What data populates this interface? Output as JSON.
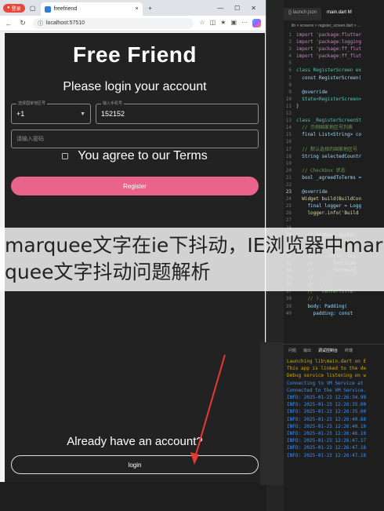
{
  "browser": {
    "profile_label": "登录",
    "tab_title": "freefriend",
    "url": "localhost:57510",
    "tab_close": "×",
    "new_tab": "+",
    "win_min": "—",
    "win_max": "☐",
    "win_close": "✕"
  },
  "app": {
    "title": "Free Friend",
    "subtitle": "Please login your account",
    "country_label": "选择国家地区号",
    "country_value": "+1",
    "phone_label": "输入手机号",
    "phone_value": "152152",
    "password_placeholder": "请输入密码",
    "agree_text": "You agree to our Terms",
    "register_label": "Register",
    "already_text": "Already have an account?",
    "login_label": "login"
  },
  "editor": {
    "tabs": [
      "{} launch.json",
      "main.dart M"
    ],
    "breadcrumb": "lib > screens > register_screen.dart > ...",
    "code": [
      {
        "n": "1",
        "t": "import 'package:flutter",
        "c": "k"
      },
      {
        "n": "2",
        "t": "import 'package:logging",
        "c": "k"
      },
      {
        "n": "3",
        "t": "import 'package:ff_flut",
        "c": "k"
      },
      {
        "n": "4",
        "t": "import 'package:ff_flut",
        "c": "k"
      },
      {
        "n": "5",
        "t": "",
        "c": ""
      },
      {
        "n": "6",
        "t": "class RegisterScreen ex",
        "c": "t"
      },
      {
        "n": "7",
        "t": "  const RegisterScreen(",
        "c": ""
      },
      {
        "n": "8",
        "t": "",
        "c": ""
      },
      {
        "n": "9",
        "t": "  @override",
        "c": ""
      },
      {
        "n": "10",
        "t": "  State<RegisterScreen>",
        "c": "t"
      },
      {
        "n": "11",
        "t": "}",
        "c": ""
      },
      {
        "n": "12",
        "t": "",
        "c": ""
      },
      {
        "n": "13",
        "t": "class _RegisterScreenSt",
        "c": "t"
      },
      {
        "n": "14",
        "t": "  // 示例国家地区号列表",
        "c": "c"
      },
      {
        "n": "15",
        "t": "  final List<String> co",
        "c": ""
      },
      {
        "n": "16",
        "t": "",
        "c": ""
      },
      {
        "n": "17",
        "t": "  // 默认选择的国家地区号",
        "c": "c"
      },
      {
        "n": "18",
        "t": "  String selectedCountr",
        "c": ""
      },
      {
        "n": "19",
        "t": "",
        "c": ""
      },
      {
        "n": "20",
        "t": "  // Checkbox 状态",
        "c": "c"
      },
      {
        "n": "21",
        "t": "  bool _agreedToTerms =",
        "c": ""
      },
      {
        "n": "22",
        "t": "",
        "c": ""
      },
      {
        "n": "23",
        "t": "  @override",
        "c": ""
      },
      {
        "n": "24",
        "t": "  Widget build(BuildCon",
        "c": "f"
      },
      {
        "n": "25",
        "t": "    final logger = Logg",
        "c": ""
      },
      {
        "n": "26",
        "t": "    logger.info('Build",
        "c": "f"
      },
      {
        "n": "27",
        "t": "",
        "c": ""
      },
      {
        "n": "28",
        "t": "",
        "c": ""
      },
      {
        "n": "29",
        "t": "    // appBar: AppBar",
        "c": "c"
      },
      {
        "n": "30",
        "t": "    //   title: const",
        "c": "c"
      },
      {
        "n": "31",
        "t": "    //     'Free Frie",
        "c": "c"
      },
      {
        "n": "32",
        "t": "    //     style: Tex",
        "c": "c"
      },
      {
        "n": "33",
        "t": "    //       fontSize",
        "c": "c"
      },
      {
        "n": "34",
        "t": "    //       fontWeig",
        "c": "c"
      },
      {
        "n": "35",
        "t": "    //     ),",
        "c": "c"
      },
      {
        "n": "36",
        "t": "    //   ),",
        "c": "c"
      },
      {
        "n": "37",
        "t": "    //   centerTitle:",
        "c": "c"
      },
      {
        "n": "38",
        "t": "    // ),",
        "c": "c"
      },
      {
        "n": "39",
        "t": "    body: Padding(",
        "c": ""
      },
      {
        "n": "40",
        "t": "      padding: const",
        "c": ""
      }
    ],
    "panel_tabs": [
      "问题",
      "输出",
      "调试控制台",
      "终端"
    ],
    "console": [
      {
        "t": "Launching lib\\main.dart on E",
        "c": "y"
      },
      {
        "t": "This app is linked to the de",
        "c": "y"
      },
      {
        "t": "Debug service listening on w",
        "c": "y"
      },
      {
        "t": "Connecting to VM Service at",
        "c": ""
      },
      {
        "t": "Connected to the VM Service.",
        "c": ""
      },
      {
        "t": "INFO: 2025-01-23 12:26:34.99",
        "c": ""
      },
      {
        "t": "INFO: 2025-01-23 12:26:35.00",
        "c": ""
      },
      {
        "t": "INFO: 2025-01-23 12:26:35.00",
        "c": ""
      },
      {
        "t": "INFO: 2025-01-23 12:26:40.88",
        "c": ""
      },
      {
        "t": "INFO: 2025-01-23 12:26:40.10",
        "c": ""
      },
      {
        "t": "INFO: 2025-01-23 12:26:46.10",
        "c": ""
      },
      {
        "t": "INFO: 2025-01-23 12:26:47.17",
        "c": ""
      },
      {
        "t": "INFO: 2025-01-23 12:26:47.18",
        "c": ""
      },
      {
        "t": "INFO: 2025-01-23 12:26:47.18",
        "c": ""
      }
    ]
  },
  "overlay": {
    "text": "marquee文字在ie下抖动，IE浏览器中marquee文字抖动问题解析"
  },
  "colors": {
    "register_pink": "#e9638a",
    "app_bg": "#222222",
    "arrow_red": "#e53935"
  }
}
